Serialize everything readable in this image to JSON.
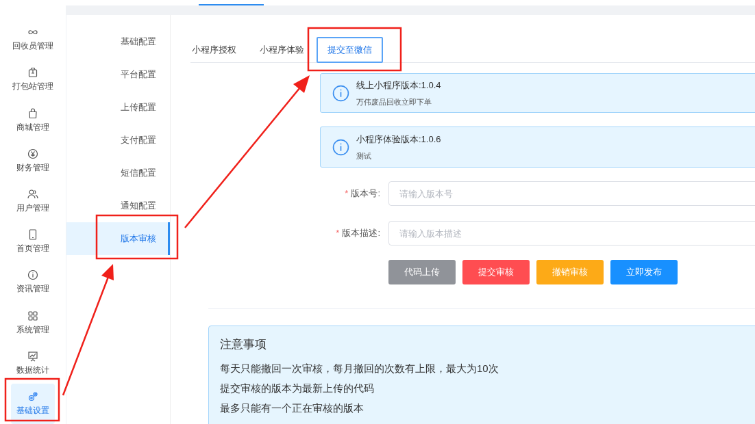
{
  "sidebar": {
    "items": [
      {
        "label": "回收员管理",
        "kind": "infinity",
        "selected": false
      },
      {
        "label": "打包站管理",
        "kind": "box",
        "selected": false
      },
      {
        "label": "商城管理",
        "kind": "bag",
        "selected": false
      },
      {
        "label": "财务管理",
        "kind": "yen",
        "selected": false
      },
      {
        "label": "用户管理",
        "kind": "users",
        "selected": false
      },
      {
        "label": "首页管理",
        "kind": "phone",
        "selected": false
      },
      {
        "label": "资讯管理",
        "kind": "info",
        "selected": false
      },
      {
        "label": "系统管理",
        "kind": "grid",
        "selected": false
      },
      {
        "label": "数据统计",
        "kind": "chart",
        "selected": false
      },
      {
        "label": "基础设置",
        "kind": "gears",
        "selected": true
      }
    ]
  },
  "submenu": {
    "items": [
      {
        "label": "基础配置",
        "selected": false
      },
      {
        "label": "平台配置",
        "selected": false
      },
      {
        "label": "上传配置",
        "selected": false
      },
      {
        "label": "支付配置",
        "selected": false
      },
      {
        "label": "短信配置",
        "selected": false
      },
      {
        "label": "通知配置",
        "selected": false
      },
      {
        "label": "版本审核",
        "selected": true
      }
    ]
  },
  "tabs": [
    {
      "label": "小程序授权",
      "selected": false
    },
    {
      "label": "小程序体验",
      "selected": false
    },
    {
      "label": "提交至微信",
      "selected": true
    }
  ],
  "alerts": [
    {
      "title": "线上小程序版本:1.0.4",
      "description": "万伟废品回收立即下单"
    },
    {
      "title": "小程序体验版本:1.0.6",
      "description": "测试"
    }
  ],
  "form": {
    "fields": [
      {
        "label": "版本号:",
        "required_mark": "*",
        "placeholder": "请输入版本号"
      },
      {
        "label": "版本描述:",
        "required_mark": "*",
        "placeholder": "请输入版本描述"
      }
    ],
    "buttons": [
      {
        "label": "代码上传",
        "color": "#909399"
      },
      {
        "label": "提交审核",
        "color": "#ff4d51"
      },
      {
        "label": "撤销审核",
        "color": "#fdaa17"
      },
      {
        "label": "立即发布",
        "color": "#1890ff"
      }
    ]
  },
  "notice": {
    "title": "注意事项",
    "lines": [
      "每天只能撤回一次审核，每月撤回的次数有上限，最大为10次",
      "提交审核的版本为最新上传的代码",
      "最多只能有一个正在审核的版本"
    ]
  }
}
